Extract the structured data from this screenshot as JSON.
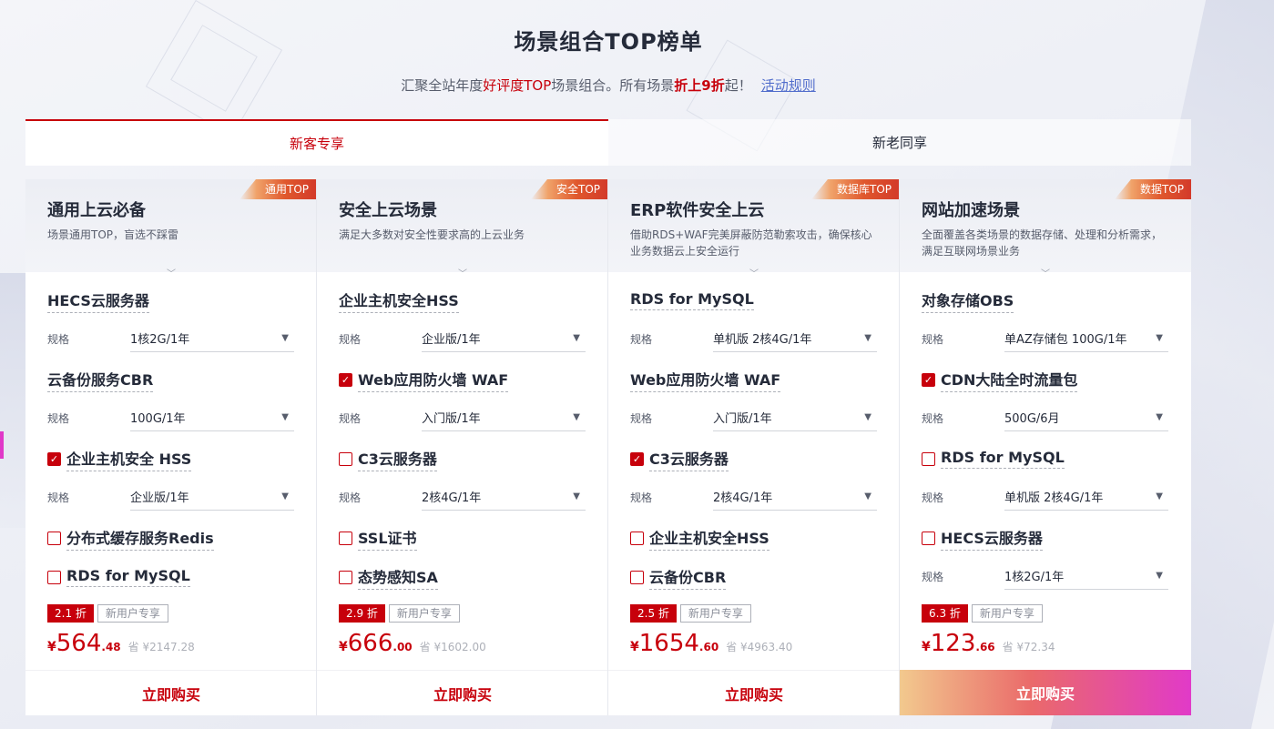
{
  "header": {
    "title": "场景组合TOP榜单",
    "sub_1": "汇聚全站年度",
    "sub_2": "好评度TOP",
    "sub_3": "场景组合。所有场景",
    "sub_4": "折上9折",
    "sub_5": "起！",
    "rules_link": "活动规则"
  },
  "tabs": [
    {
      "label": "新客专享",
      "active": true
    },
    {
      "label": "新老同享",
      "active": false
    }
  ],
  "spec_label": "规格",
  "cards": [
    {
      "badge": "通用TOP",
      "title": "通用上云必备",
      "desc": "场景通用TOP，盲选不踩雷",
      "items": [
        {
          "name": "HECS云服务器",
          "checkbox": "none",
          "spec": "1核2G/1年"
        },
        {
          "name": "云备份服务CBR",
          "checkbox": "none",
          "spec": "100G/1年"
        },
        {
          "name": "企业主机安全 HSS",
          "checkbox": "checked",
          "spec": "企业版/1年"
        },
        {
          "name": "分布式缓存服务Redis",
          "checkbox": "unchecked"
        },
        {
          "name": "RDS for MySQL",
          "checkbox": "unchecked"
        }
      ],
      "discount": "2.1 折",
      "user_tag": "新用户专享",
      "price_yen": "¥",
      "price_int": "564",
      "price_dec": ".48",
      "orig_price": "省 ¥2147.28",
      "buy": "立即购买"
    },
    {
      "badge": "安全TOP",
      "title": "安全上云场景",
      "desc": "满足大多数对安全性要求高的上云业务",
      "items": [
        {
          "name": "企业主机安全HSS",
          "checkbox": "none",
          "spec": "企业版/1年"
        },
        {
          "name": "Web应用防火墙 WAF",
          "checkbox": "checked",
          "spec": "入门版/1年"
        },
        {
          "name": "C3云服务器",
          "checkbox": "unchecked",
          "spec": "2核4G/1年"
        },
        {
          "name": "SSL证书",
          "checkbox": "unchecked"
        },
        {
          "name": "态势感知SA",
          "checkbox": "unchecked"
        }
      ],
      "discount": "2.9 折",
      "user_tag": "新用户专享",
      "price_yen": "¥",
      "price_int": "666",
      "price_dec": ".00",
      "orig_price": "省 ¥1602.00",
      "buy": "立即购买"
    },
    {
      "badge": "数据库TOP",
      "title": "ERP软件安全上云",
      "desc": "借助RDS+WAF完美屏蔽防范勒索攻击，确保核心业务数据云上安全运行",
      "items": [
        {
          "name": "RDS for MySQL",
          "checkbox": "none",
          "spec": "单机版 2核4G/1年"
        },
        {
          "name": "Web应用防火墙 WAF",
          "checkbox": "none",
          "spec": "入门版/1年"
        },
        {
          "name": "C3云服务器",
          "checkbox": "checked",
          "spec": "2核4G/1年"
        },
        {
          "name": "企业主机安全HSS",
          "checkbox": "unchecked"
        },
        {
          "name": "云备份CBR",
          "checkbox": "unchecked"
        }
      ],
      "discount": "2.5 折",
      "user_tag": "新用户专享",
      "price_yen": "¥",
      "price_int": "1654",
      "price_dec": ".60",
      "orig_price": "省 ¥4963.40",
      "buy": "立即购买"
    },
    {
      "badge": "数据TOP",
      "title": "网站加速场景",
      "desc": "全面覆盖各类场景的数据存储、处理和分析需求，满足互联网场景业务",
      "items": [
        {
          "name": "对象存储OBS",
          "checkbox": "none",
          "spec": "单AZ存储包 100G/1年"
        },
        {
          "name": "CDN大陆全时流量包",
          "checkbox": "checked",
          "spec": "500G/6月"
        },
        {
          "name": "RDS for MySQL",
          "checkbox": "unchecked",
          "spec": "单机版 2核4G/1年"
        },
        {
          "name": "HECS云服务器",
          "checkbox": "unchecked",
          "spec": "1核2G/1年"
        }
      ],
      "discount": "6.3 折",
      "user_tag": "新用户专享",
      "price_yen": "¥",
      "price_int": "123",
      "price_dec": ".66",
      "orig_price": "省 ¥72.34",
      "buy": "立即购买"
    }
  ]
}
